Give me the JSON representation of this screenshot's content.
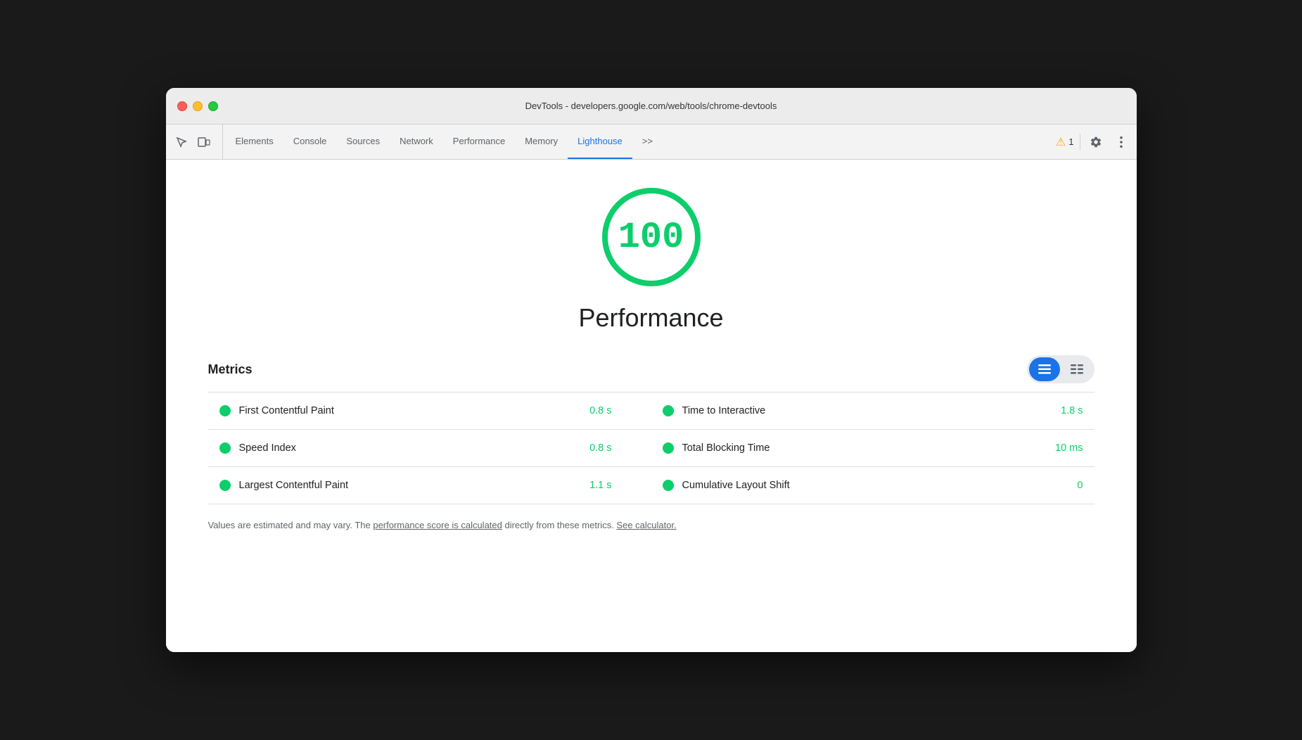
{
  "window": {
    "title": "DevTools - developers.google.com/web/tools/chrome-devtools"
  },
  "toolbar": {
    "tabs": [
      {
        "id": "elements",
        "label": "Elements",
        "active": false
      },
      {
        "id": "console",
        "label": "Console",
        "active": false
      },
      {
        "id": "sources",
        "label": "Sources",
        "active": false
      },
      {
        "id": "network",
        "label": "Network",
        "active": false
      },
      {
        "id": "performance",
        "label": "Performance",
        "active": false
      },
      {
        "id": "memory",
        "label": "Memory",
        "active": false
      },
      {
        "id": "lighthouse",
        "label": "Lighthouse",
        "active": true
      }
    ],
    "more_tabs_label": ">>",
    "warning_count": "1",
    "settings_label": "⚙",
    "more_label": "⋮"
  },
  "score_section": {
    "score": "100",
    "label": "Performance"
  },
  "metrics": {
    "title": "Metrics",
    "rows": [
      {
        "left_name": "First Contentful Paint",
        "left_value": "0.8 s",
        "right_name": "Time to Interactive",
        "right_value": "1.8 s"
      },
      {
        "left_name": "Speed Index",
        "left_value": "0.8 s",
        "right_name": "Total Blocking Time",
        "right_value": "10 ms"
      },
      {
        "left_name": "Largest Contentful Paint",
        "left_value": "1.1 s",
        "right_name": "Cumulative Layout Shift",
        "right_value": "0"
      }
    ]
  },
  "footer": {
    "text_before_link1": "Values are estimated and may vary. The ",
    "link1_text": "performance score is calculated",
    "text_between": " directly from these metrics. ",
    "link2_text": "See calculator.",
    "text_after": ""
  },
  "colors": {
    "green": "#0cce6b",
    "blue": "#1a73e8",
    "text_primary": "#202124",
    "text_secondary": "#5f6368"
  }
}
